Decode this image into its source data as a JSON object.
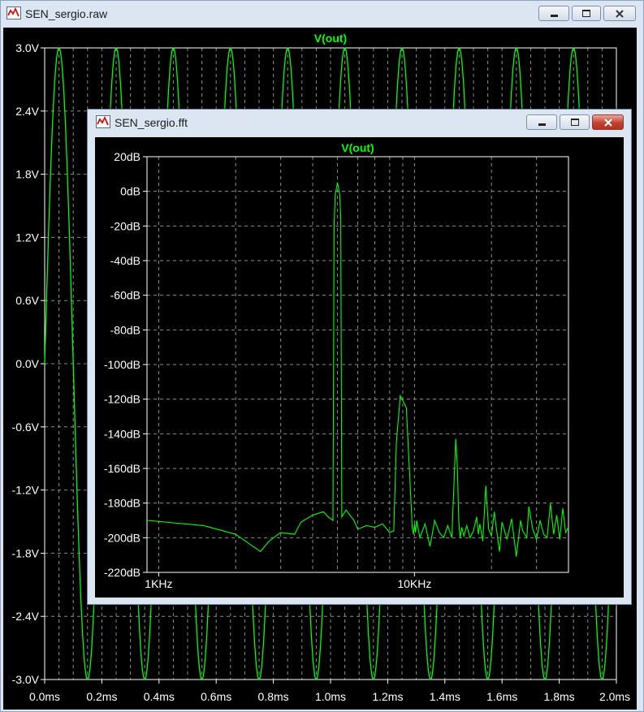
{
  "raw_window": {
    "title": "SEN_sergio.raw",
    "icon": "waveform-icon",
    "controls": {
      "minimize": "minimize-icon",
      "maximize": "maximize-icon",
      "close": "close-icon"
    }
  },
  "fft_window": {
    "title": "SEN_sergio.fft",
    "icon": "waveform-icon",
    "controls": {
      "minimize": "minimize-icon",
      "maximize": "maximize-icon",
      "close": "close-icon"
    }
  },
  "colors": {
    "trace": "#00ff00",
    "grid": "#8c8c8c",
    "plot_bg": "#000000",
    "tick_text": "#ffffff",
    "title_text": "#00ff00"
  },
  "chart_data": [
    {
      "type": "line",
      "title": "V(out)",
      "xlabel": "",
      "ylabel": "",
      "grid": true,
      "xlim": [
        0,
        2.0
      ],
      "ylim": [
        -3.0,
        3.0
      ],
      "x_ticks": [
        "0.0ms",
        "0.2ms",
        "0.4ms",
        "0.6ms",
        "0.8ms",
        "1.0ms",
        "1.2ms",
        "1.4ms",
        "1.6ms",
        "1.8ms",
        "2.0ms"
      ],
      "y_ticks": [
        "3.0V",
        "2.4V",
        "1.8V",
        "1.2V",
        "0.6V",
        "0.0V",
        "-0.6V",
        "-1.2V",
        "-1.8V",
        "-2.4V",
        "-3.0V"
      ],
      "series": [
        {
          "amplitude": 3.0,
          "frequency_khz": 5,
          "waveform": "sine"
        }
      ]
    },
    {
      "type": "line",
      "title": "V(out)",
      "xlabel": "",
      "ylabel": "",
      "grid": true,
      "x_scale": "log",
      "xlim": [
        900,
        40000
      ],
      "ylim": [
        -220,
        20
      ],
      "x_ticks": [
        "1KHz",
        "10KHz"
      ],
      "y_ticks": [
        "20dB",
        "0dB",
        "-20dB",
        "-40dB",
        "-60dB",
        "-80dB",
        "-100dB",
        "-120dB",
        "-140dB",
        "-160dB",
        "-180dB",
        "-200dB",
        "-220dB"
      ],
      "series": [
        {
          "x": [
            900,
            1500,
            2000,
            2500,
            2700,
            3000,
            3400,
            3600,
            4000,
            4400,
            4600,
            4800,
            4850,
            4900,
            5000,
            5100,
            5150,
            5200,
            5400,
            5800,
            6000,
            6500,
            7000,
            7500,
            8000,
            8300,
            8500,
            8800,
            9300,
            9800,
            9900,
            10000,
            10100,
            10200,
            10500,
            11000,
            11500,
            12000,
            12500,
            13000,
            13500,
            14000,
            14500,
            14700,
            14900,
            15000,
            15100,
            15300,
            15600,
            16000,
            16500,
            17000,
            17500,
            17800,
            18000,
            18500,
            19000,
            19500,
            20000,
            20500,
            21000,
            21500,
            22000,
            23000,
            24000,
            25000,
            26000,
            26500,
            27000,
            27500,
            28000,
            29000,
            30000,
            31000,
            32000,
            33000,
            34000,
            35000,
            36000,
            37000,
            38000,
            39000,
            40000
          ],
          "y": [
            -190,
            -193,
            -198,
            -208,
            -202,
            -197,
            -198,
            -191,
            -187,
            -185,
            -188,
            -190,
            -20,
            -2,
            5,
            -2,
            -15,
            -188,
            -184,
            -190,
            -195,
            -193,
            -194,
            -192,
            -197,
            -196,
            -145,
            -118,
            -125,
            -194,
            -198,
            -192,
            -197,
            -190,
            -200,
            -192,
            -205,
            -190,
            -197,
            -200,
            -193,
            -200,
            -143,
            -158,
            -190,
            -196,
            -200,
            -194,
            -199,
            -193,
            -200,
            -196,
            -188,
            -198,
            -192,
            -202,
            -170,
            -195,
            -199,
            -185,
            -197,
            -208,
            -191,
            -201,
            -189,
            -211,
            -190,
            -196,
            -198,
            -200,
            -182,
            -195,
            -201,
            -190,
            -198,
            -200,
            -180,
            -198,
            -187,
            -201,
            -183,
            -197,
            -194
          ]
        }
      ]
    }
  ]
}
